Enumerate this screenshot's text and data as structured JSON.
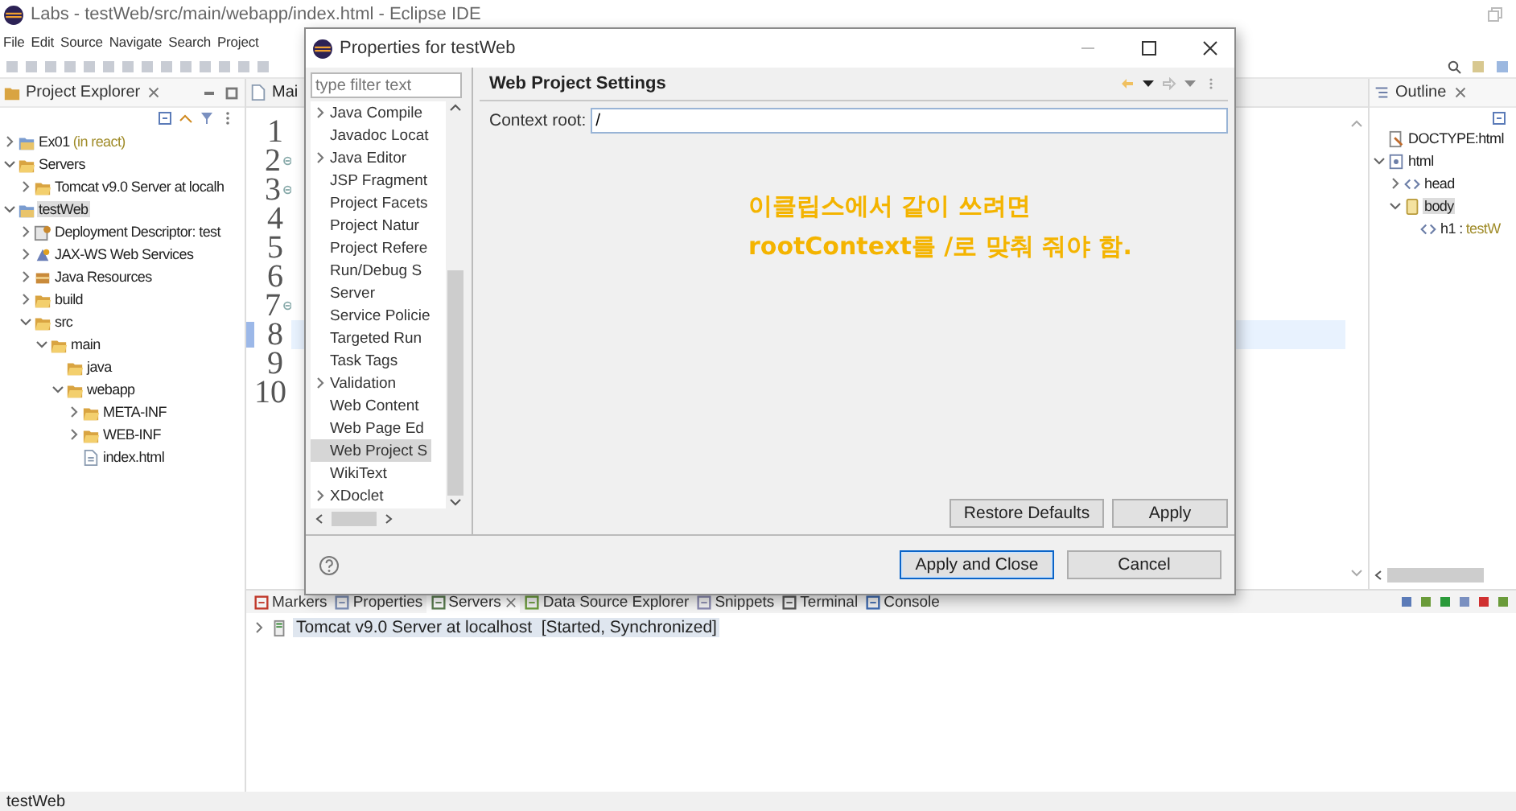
{
  "window": {
    "title": "Labs - testWeb/src/main/webapp/index.html - Eclipse IDE"
  },
  "menu": [
    "File",
    "Edit",
    "Source",
    "Navigate",
    "Search",
    "Project"
  ],
  "project_explorer": {
    "title": "Project Explorer",
    "items": [
      {
        "label": "Ex01",
        "decoration": "(in react)",
        "kind": "project",
        "expanded": false,
        "selected": false
      },
      {
        "label": "Servers",
        "kind": "folder",
        "expanded": true,
        "selected": false,
        "children": [
          {
            "label": "Tomcat v9.0 Server at localh",
            "kind": "folder",
            "expanded": false,
            "selected": false
          }
        ]
      },
      {
        "label": "testWeb",
        "kind": "project",
        "expanded": true,
        "selected": true,
        "children": [
          {
            "label": "Deployment Descriptor: test",
            "kind": "descriptor",
            "expanded": false,
            "selected": false
          },
          {
            "label": "JAX-WS Web Services",
            "kind": "services",
            "expanded": false,
            "selected": false
          },
          {
            "label": "Java Resources",
            "kind": "resources",
            "expanded": false,
            "selected": false
          },
          {
            "label": "build",
            "kind": "folder",
            "expanded": false,
            "selected": false
          },
          {
            "label": "src",
            "kind": "folder",
            "expanded": true,
            "selected": false,
            "children": [
              {
                "label": "main",
                "kind": "folder",
                "expanded": true,
                "selected": false,
                "children": [
                  {
                    "label": "java",
                    "kind": "folder",
                    "selected": false
                  },
                  {
                    "label": "webapp",
                    "kind": "folder",
                    "expanded": true,
                    "selected": false,
                    "children": [
                      {
                        "label": "META-INF",
                        "kind": "folder",
                        "expanded": false,
                        "selected": false
                      },
                      {
                        "label": "WEB-INF",
                        "kind": "folder",
                        "expanded": false,
                        "selected": false
                      },
                      {
                        "label": "index.html",
                        "kind": "file",
                        "selected": false
                      }
                    ]
                  }
                ]
              }
            ]
          }
        ]
      }
    ]
  },
  "editor": {
    "tab": "Mai",
    "lines": [
      {
        "number": "1",
        "fold": false,
        "current": false
      },
      {
        "number": "2",
        "fold": true,
        "current": false
      },
      {
        "number": "3",
        "fold": true,
        "current": false
      },
      {
        "number": "4",
        "fold": false,
        "current": false
      },
      {
        "number": "5",
        "fold": false,
        "current": false
      },
      {
        "number": "6",
        "fold": false,
        "current": false
      },
      {
        "number": "7",
        "fold": true,
        "current": false
      },
      {
        "number": "8",
        "fold": false,
        "current": true
      },
      {
        "number": "9",
        "fold": false,
        "current": false
      },
      {
        "number": "10",
        "fold": false,
        "current": false
      }
    ]
  },
  "outline": {
    "title": "Outline",
    "items": [
      {
        "label": "DOCTYPE:html",
        "kind": "doctype",
        "selected": false
      },
      {
        "label": "html",
        "kind": "document",
        "expanded": true,
        "selected": false,
        "children": [
          {
            "label": "head",
            "kind": "tag",
            "expanded": false,
            "selected": false
          },
          {
            "label": "body",
            "kind": "body",
            "expanded": true,
            "selected": true,
            "children": [
              {
                "label": "h1 :",
                "decoration": "testW",
                "kind": "tag",
                "selected": false
              }
            ]
          }
        ]
      }
    ]
  },
  "dialog": {
    "title": "Properties for testWeb",
    "filter": {
      "placeholder": "type filter text"
    },
    "pages": [
      {
        "label": "Java Compile",
        "expanded": false,
        "selected": false
      },
      {
        "label": "Javadoc Locat",
        "selected": false
      },
      {
        "label": "Java Editor",
        "expanded": false,
        "selected": false
      },
      {
        "label": "JSP Fragment",
        "selected": false
      },
      {
        "label": "Project Facets",
        "selected": false
      },
      {
        "label": "Project Natur",
        "selected": false
      },
      {
        "label": "Project Refere",
        "selected": false
      },
      {
        "label": "Run/Debug S",
        "selected": false
      },
      {
        "label": "Server",
        "selected": false
      },
      {
        "label": "Service Policie",
        "selected": false
      },
      {
        "label": "Targeted Run",
        "selected": false
      },
      {
        "label": "Task Tags",
        "selected": false
      },
      {
        "label": "Validation",
        "expanded": false,
        "selected": false
      },
      {
        "label": "Web Content",
        "selected": false
      },
      {
        "label": "Web Page Ed",
        "selected": false
      },
      {
        "label": "Web Project S",
        "selected": true
      },
      {
        "label": "WikiText",
        "selected": false
      },
      {
        "label": "XDoclet",
        "expanded": false,
        "selected": false
      }
    ],
    "page_title": "Web Project Settings",
    "fields": [
      {
        "label": "Context root:",
        "value": "/"
      }
    ],
    "note": [
      "이클립스에서 같이 쓰려면",
      "rootContext를 /로 맞춰 줘야 함."
    ],
    "buttons": [
      "Restore Defaults",
      "Apply"
    ],
    "footer_buttons": [
      {
        "label": "Apply and Close",
        "default": true
      },
      {
        "label": "Cancel",
        "default": false
      }
    ]
  },
  "bottom_panel": {
    "tabs": [
      {
        "label": "Markers",
        "kind": "markers",
        "selected": false
      },
      {
        "label": "Properties",
        "kind": "properties",
        "selected": false
      },
      {
        "label": "Servers",
        "kind": "servers",
        "selected": true,
        "closable": true
      },
      {
        "label": "Data Source Explorer",
        "kind": "datasource",
        "selected": false
      },
      {
        "label": "Snippets",
        "kind": "snippets",
        "selected": false
      },
      {
        "label": "Terminal",
        "kind": "terminal",
        "selected": false
      },
      {
        "label": "Console",
        "kind": "console",
        "selected": false
      }
    ],
    "servers": [
      {
        "label": "Tomcat v9.0 Server at localhost",
        "state": "[Started, Synchronized]",
        "selected": true
      }
    ]
  },
  "status_bar": {
    "text": "testWeb"
  }
}
